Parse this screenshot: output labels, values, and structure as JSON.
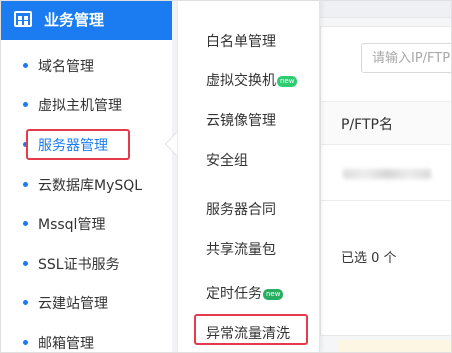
{
  "sidebar": {
    "header_title": "业务管理",
    "items": [
      {
        "label": "域名管理"
      },
      {
        "label": "虚拟主机管理"
      },
      {
        "label": "服务器管理"
      },
      {
        "label": "云数据库MySQL"
      },
      {
        "label": "Mssql管理"
      },
      {
        "label": "SSL证书服务"
      },
      {
        "label": "云建站管理"
      },
      {
        "label": "邮箱管理"
      }
    ],
    "active_item": "服务器管理"
  },
  "submenu": {
    "items": [
      {
        "label": "白名单管理",
        "badge": ""
      },
      {
        "label": "虚拟交换机",
        "badge": "new"
      },
      {
        "label": "云镜像管理",
        "badge": ""
      },
      {
        "label": "安全组",
        "badge": ""
      },
      {
        "label": "服务器合同",
        "badge": ""
      },
      {
        "label": "共享流量包",
        "badge": ""
      },
      {
        "label": "定时任务",
        "badge": "new"
      },
      {
        "label": "异常流量清洗",
        "badge": ""
      }
    ],
    "highlighted_item": "异常流量清洗"
  },
  "main": {
    "search_placeholder": "请输入IP/FTP",
    "column_header": "P/FTP名",
    "selected_text": "已选 0 个"
  },
  "colors": {
    "accent": "#1a7cf0",
    "highlight_border": "#e53a4b",
    "new_badge": "#2ecc71"
  }
}
